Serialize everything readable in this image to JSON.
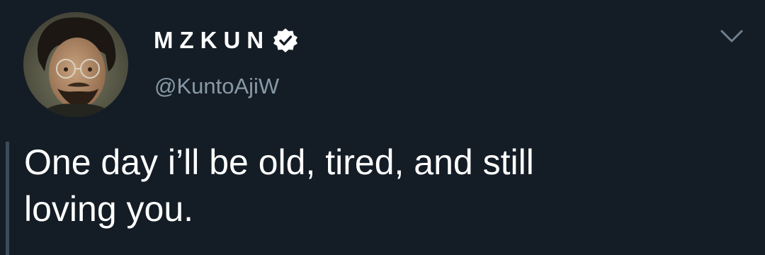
{
  "tweet": {
    "author": {
      "display_name": "MZKUN",
      "verified": true,
      "handle": "@KuntoAjiW",
      "avatar_icon": "user-avatar-photo"
    },
    "text": "One day i’ll be old, tired, and still\nloving you.",
    "menu_icon": "chevron-down-icon"
  },
  "colors": {
    "background": "#141d26",
    "text_primary": "#ffffff",
    "text_secondary": "#8899a6",
    "thread_line": "#3d4a57"
  }
}
